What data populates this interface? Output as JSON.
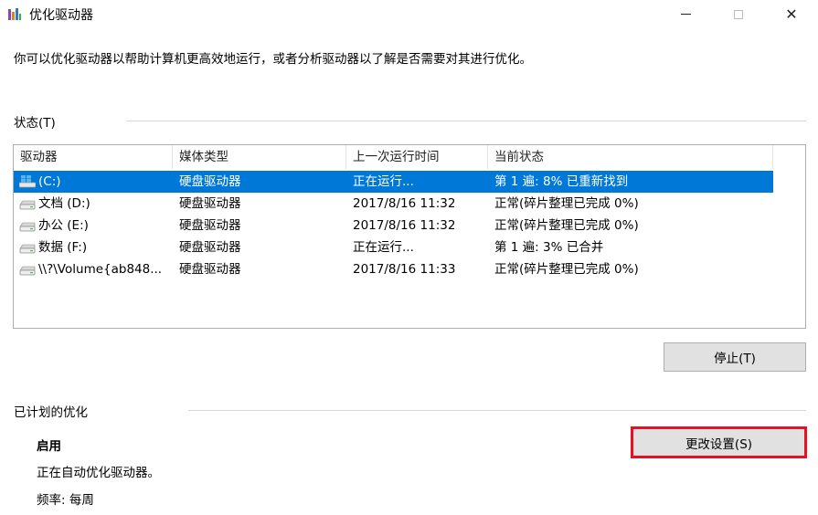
{
  "window": {
    "title": "优化驱动器",
    "minimize_glyph": "",
    "close_glyph": "✕"
  },
  "description": "你可以优化驱动器以帮助计算机更高效地运行，或者分析驱动器以了解是否需要对其进行优化。",
  "status_section": {
    "label": "状态(T)"
  },
  "drive_table": {
    "columns": [
      "驱动器",
      "媒体类型",
      "上一次运行时间",
      "当前状态"
    ],
    "rows": [
      {
        "drive": "(C:)",
        "media": "硬盘驱动器",
        "last_run": "正在运行...",
        "status": "第 1 遍: 8% 已重新找到",
        "selected": true,
        "icon": "windows-drive-icon"
      },
      {
        "drive": "文档 (D:)",
        "media": "硬盘驱动器",
        "last_run": "2017/8/16 11:32",
        "status": "正常(碎片整理已完成 0%)",
        "selected": false,
        "icon": "hard-drive-icon"
      },
      {
        "drive": "办公 (E:)",
        "media": "硬盘驱动器",
        "last_run": "2017/8/16 11:32",
        "status": "正常(碎片整理已完成 0%)",
        "selected": false,
        "icon": "hard-drive-icon"
      },
      {
        "drive": "数据 (F:)",
        "media": "硬盘驱动器",
        "last_run": "正在运行...",
        "status": "第 1 遍: 3% 已合并",
        "selected": false,
        "icon": "hard-drive-icon"
      },
      {
        "drive": "\\\\?\\Volume{ab848...",
        "media": "硬盘驱动器",
        "last_run": "2017/8/16 11:33",
        "status": "正常(碎片整理已完成 0%)",
        "selected": false,
        "icon": "hard-drive-icon"
      }
    ]
  },
  "buttons": {
    "stop": "停止(T)",
    "change_settings": "更改设置(S)"
  },
  "scheduled_section": {
    "label": "已计划的优化",
    "state": "启用",
    "detail": "正在自动优化驱动器。",
    "frequency": "频率: 每周"
  },
  "colors": {
    "selection": "#0078d7",
    "highlight_border": "#e81123",
    "button_bg": "#e1e1e1"
  }
}
